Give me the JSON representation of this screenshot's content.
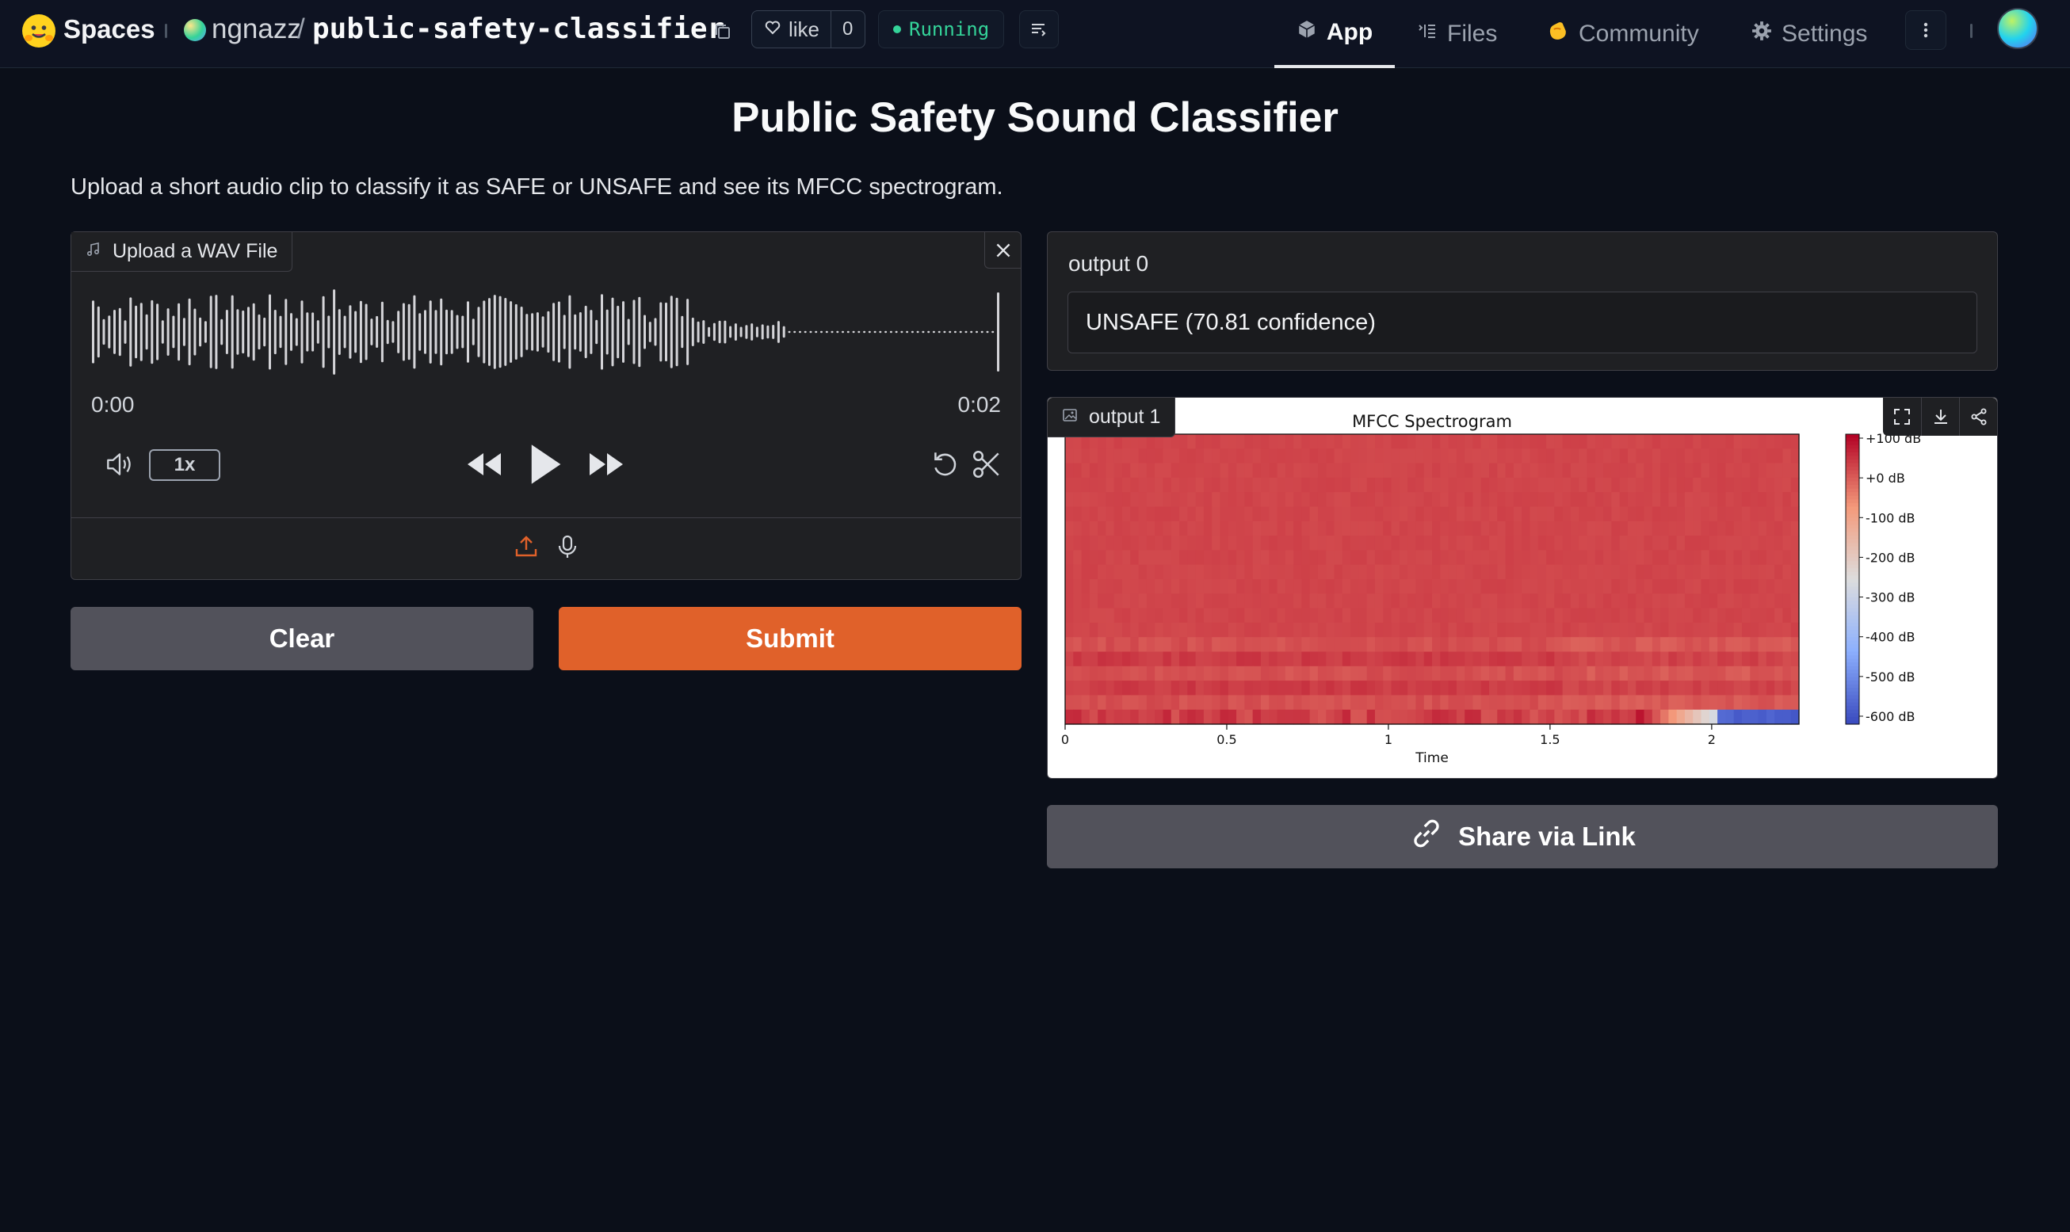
{
  "header": {
    "spaces_label": "Spaces",
    "owner": "ngnazz",
    "slash": "/",
    "repo": "public-safety-classifier",
    "like_label": "like",
    "like_count": "0",
    "status": "Running",
    "tabs": [
      {
        "label": "App",
        "icon": "cube-icon",
        "active": true
      },
      {
        "label": "Files",
        "icon": "files-icon",
        "active": false
      },
      {
        "label": "Community",
        "icon": "community-icon",
        "active": false
      },
      {
        "label": "Settings",
        "icon": "gear-icon",
        "active": false
      }
    ]
  },
  "main": {
    "title": "Public Safety Sound Classifier",
    "description": "Upload a short audio clip to classify it as SAFE or UNSAFE and see its MFCC spectrogram."
  },
  "audio_input": {
    "label": "Upload a WAV File",
    "time_current": "0:00",
    "time_total": "0:02",
    "speed": "1x"
  },
  "buttons": {
    "clear": "Clear",
    "submit": "Submit",
    "share": "Share via Link"
  },
  "output0": {
    "label": "output 0",
    "value": "UNSAFE (70.81 confidence)"
  },
  "output1": {
    "label": "output 1"
  },
  "chart_data": {
    "type": "heatmap",
    "title": "MFCC Spectrogram",
    "xlabel": "Time",
    "ylabel": "",
    "xlim": [
      0,
      2.27
    ],
    "x_ticks": [
      "0",
      "0.5",
      "1",
      "1.5",
      "2"
    ],
    "x_tick_values": [
      0,
      0.5,
      1,
      1.5,
      2
    ],
    "colorbar_labels": [
      "+100 dB",
      "+0 dB",
      "-100 dB",
      "-200 dB",
      "-300 dB",
      "-400 dB",
      "-500 dB",
      "-600 dB"
    ],
    "colorbar_values": [
      100,
      0,
      -100,
      -200,
      -300,
      -400,
      -500,
      -600
    ],
    "colormap": "coolwarm",
    "vmin": -620,
    "vmax": 110
  },
  "colors": {
    "accent": "#e0612a",
    "running": "#34d399",
    "background": "#0b0f19"
  }
}
